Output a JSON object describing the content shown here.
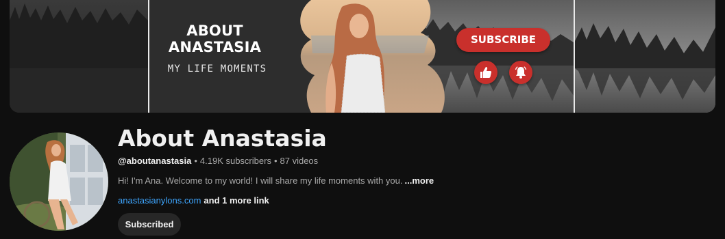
{
  "banner": {
    "title_line1": "ABOUT",
    "title_line2": "ANASTASIA",
    "subtitle": "MY LIFE MOMENTS",
    "subscribe_label": "SUBSCRIBE",
    "like_icon": "thumbs-up-icon",
    "bell_icon": "bell-icon",
    "accent_color": "#c9302c"
  },
  "channel": {
    "name": "About Anastasia",
    "handle": "@aboutanastasia",
    "separator": "•",
    "subscribers": "4.19K subscribers",
    "videos": "87 videos",
    "description": "Hi! I'm Ana. Welcome to my world! I will share my life moments with you.",
    "more_label": "...more",
    "link_text": "anastasianylons.com",
    "more_links": "and 1 more link",
    "subscribed_label": "Subscribed",
    "link_color": "#3ea6ff"
  }
}
